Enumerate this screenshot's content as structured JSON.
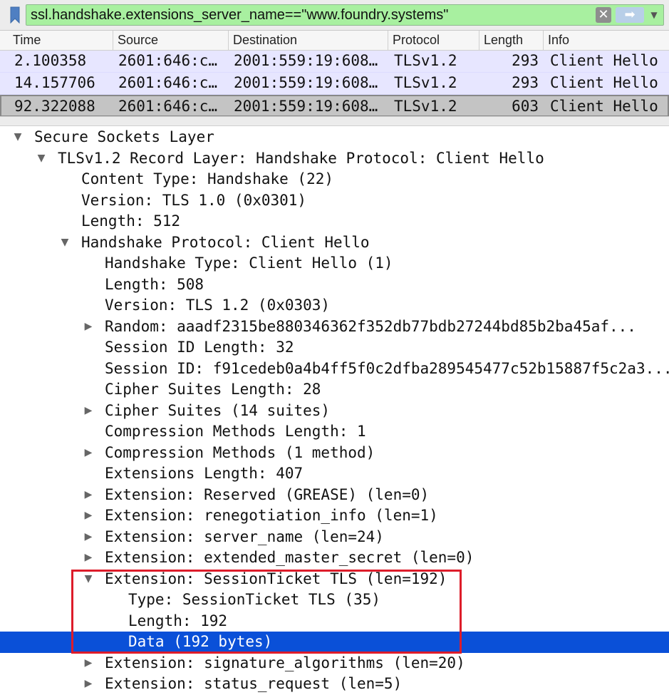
{
  "filter": {
    "expression": "ssl.handshake.extensions_server_name==\"www.foundry.systems\"",
    "clear_icon": "✕",
    "apply_icon": "➡",
    "dropdown_icon": "▼"
  },
  "packet_list": {
    "columns": [
      "Time",
      "Source",
      "Destination",
      "Protocol",
      "Length",
      "Info"
    ],
    "rows": [
      {
        "time": "2.100358",
        "source": "2601:646:c…",
        "destination": "2001:559:19:608…",
        "protocol": "TLSv1.2",
        "length": "293",
        "info": "Client Hello"
      },
      {
        "time": "14.157706",
        "source": "2601:646:c…",
        "destination": "2001:559:19:608…",
        "protocol": "TLSv1.2",
        "length": "293",
        "info": "Client Hello"
      },
      {
        "time": "92.322088",
        "source": "2601:646:c…",
        "destination": "2001:559:19:608…",
        "protocol": "TLSv1.2",
        "length": "603",
        "info": "Client Hello"
      }
    ]
  },
  "tree": [
    {
      "text": "Secure Sockets Layer",
      "level": 0,
      "expander": "▼"
    },
    {
      "text": "TLSv1.2 Record Layer: Handshake Protocol: Client Hello",
      "level": 1,
      "expander": "▼"
    },
    {
      "text": "Content Type: Handshake (22)",
      "level": 2,
      "expander": ""
    },
    {
      "text": "Version: TLS 1.0 (0x0301)",
      "level": 2,
      "expander": ""
    },
    {
      "text": "Length: 512",
      "level": 2,
      "expander": ""
    },
    {
      "text": "Handshake Protocol: Client Hello",
      "level": 2,
      "expander": "▼"
    },
    {
      "text": "Handshake Type: Client Hello (1)",
      "level": 3,
      "expander": ""
    },
    {
      "text": "Length: 508",
      "level": 3,
      "expander": ""
    },
    {
      "text": "Version: TLS 1.2 (0x0303)",
      "level": 3,
      "expander": ""
    },
    {
      "text": "Random: aaadf2315be880346362f352db77bdb27244bd85b2ba45af...",
      "level": 3,
      "expander": "▶"
    },
    {
      "text": "Session ID Length: 32",
      "level": 3,
      "expander": ""
    },
    {
      "text": "Session ID: f91cedeb0a4b4ff5f0c2dfba289545477c52b15887f5c2a3...",
      "level": 3,
      "expander": ""
    },
    {
      "text": "Cipher Suites Length: 28",
      "level": 3,
      "expander": ""
    },
    {
      "text": "Cipher Suites (14 suites)",
      "level": 3,
      "expander": "▶"
    },
    {
      "text": "Compression Methods Length: 1",
      "level": 3,
      "expander": ""
    },
    {
      "text": "Compression Methods (1 method)",
      "level": 3,
      "expander": "▶"
    },
    {
      "text": "Extensions Length: 407",
      "level": 3,
      "expander": ""
    },
    {
      "text": "Extension: Reserved (GREASE) (len=0)",
      "level": 3,
      "expander": "▶"
    },
    {
      "text": "Extension: renegotiation_info (len=1)",
      "level": 3,
      "expander": "▶"
    },
    {
      "text": "Extension: server_name (len=24)",
      "level": 3,
      "expander": "▶"
    },
    {
      "text": "Extension: extended_master_secret (len=0)",
      "level": 3,
      "expander": "▶"
    },
    {
      "text": "Extension: SessionTicket TLS (len=192)",
      "level": 3,
      "expander": "▼"
    },
    {
      "text": "Type: SessionTicket TLS (35)",
      "level": 4,
      "expander": ""
    },
    {
      "text": "Length: 192",
      "level": 4,
      "expander": ""
    },
    {
      "text": "Data (192 bytes)",
      "level": 4,
      "expander": "",
      "selected": true
    },
    {
      "text": "Extension: signature_algorithms (len=20)",
      "level": 3,
      "expander": "▶"
    },
    {
      "text": "Extension: status_request (len=5)",
      "level": 3,
      "expander": "▶"
    }
  ],
  "colors": {
    "filter_valid_bg": "#a8f0a0",
    "packet_row_bg": "#e7e6ff",
    "selected_tree_row_bg": "#0a50d8",
    "highlight_box": "#dd1c2a"
  }
}
